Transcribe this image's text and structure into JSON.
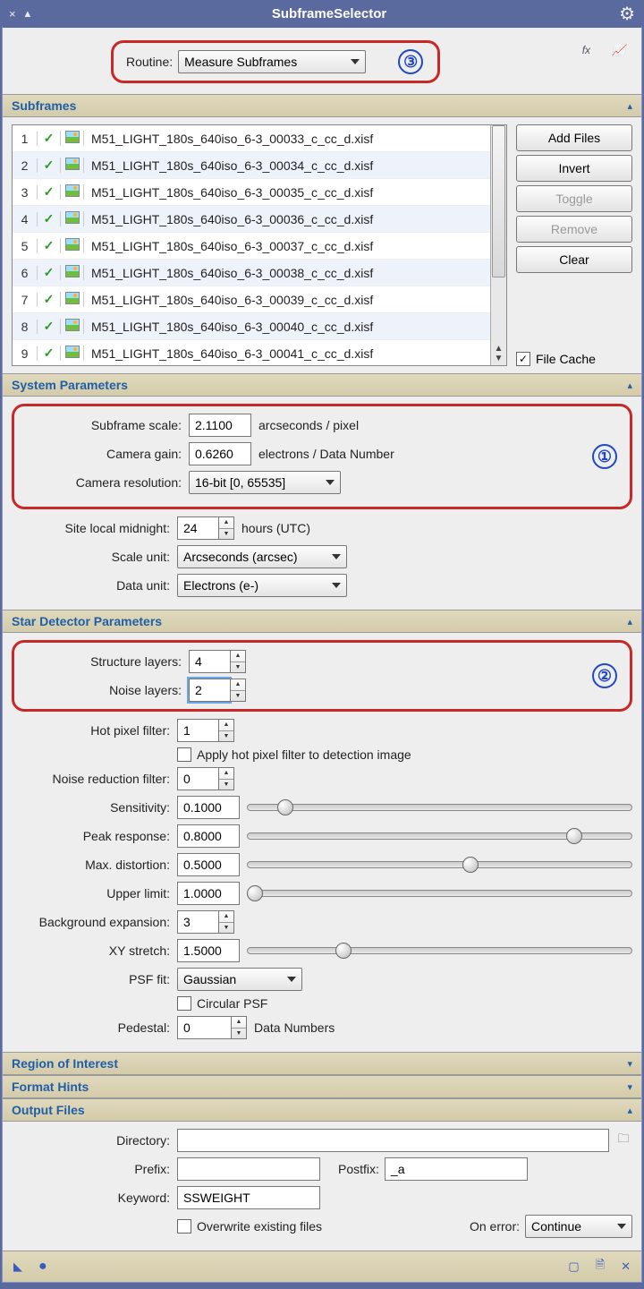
{
  "title": "SubframeSelector",
  "routine": {
    "label": "Routine:",
    "value": "Measure Subframes",
    "mark": "③"
  },
  "sections": {
    "subframes": {
      "name": "Subframes",
      "files": [
        "M51_LIGHT_180s_640iso_6-3_00033_c_cc_d.xisf",
        "M51_LIGHT_180s_640iso_6-3_00034_c_cc_d.xisf",
        "M51_LIGHT_180s_640iso_6-3_00035_c_cc_d.xisf",
        "M51_LIGHT_180s_640iso_6-3_00036_c_cc_d.xisf",
        "M51_LIGHT_180s_640iso_6-3_00037_c_cc_d.xisf",
        "M51_LIGHT_180s_640iso_6-3_00038_c_cc_d.xisf",
        "M51_LIGHT_180s_640iso_6-3_00039_c_cc_d.xisf",
        "M51_LIGHT_180s_640iso_6-3_00040_c_cc_d.xisf",
        "M51_LIGHT_180s_640iso_6-3_00041_c_cc_d.xisf"
      ],
      "buttons": {
        "add": "Add Files",
        "invert": "Invert",
        "toggle": "Toggle",
        "remove": "Remove",
        "clear": "Clear"
      },
      "filecache_label": "File Cache"
    },
    "system": {
      "name": "System Parameters",
      "subframe_scale": {
        "label": "Subframe scale:",
        "value": "2.1100",
        "unit": "arcseconds / pixel"
      },
      "camera_gain": {
        "label": "Camera gain:",
        "value": "0.6260",
        "unit": "electrons / Data Number"
      },
      "camera_res": {
        "label": "Camera resolution:",
        "value": "16-bit [0, 65535]"
      },
      "midnight": {
        "label": "Site local midnight:",
        "value": "24",
        "unit": "hours (UTC)"
      },
      "scale_unit": {
        "label": "Scale unit:",
        "value": "Arcseconds (arcsec)"
      },
      "data_unit": {
        "label": "Data unit:",
        "value": "Electrons (e-)"
      },
      "mark": "①"
    },
    "star": {
      "name": "Star Detector Parameters",
      "structure_layers": {
        "label": "Structure layers:",
        "value": "4"
      },
      "noise_layers": {
        "label": "Noise layers:",
        "value": "2"
      },
      "hot_pixel": {
        "label": "Hot pixel filter:",
        "value": "1"
      },
      "hot_pixel_check": "Apply hot pixel filter to detection image",
      "noise_reduction": {
        "label": "Noise reduction filter:",
        "value": "0"
      },
      "sensitivity": {
        "label": "Sensitivity:",
        "value": "0.1000",
        "slider": 10
      },
      "peak": {
        "label": "Peak response:",
        "value": "0.8000",
        "slider": 85
      },
      "distortion": {
        "label": "Max. distortion:",
        "value": "0.5000",
        "slider": 58
      },
      "upper": {
        "label": "Upper limit:",
        "value": "1.0000",
        "slider": 2
      },
      "bgexp": {
        "label": "Background expansion:",
        "value": "3"
      },
      "xystretch": {
        "label": "XY stretch:",
        "value": "1.5000",
        "slider": 25
      },
      "psf": {
        "label": "PSF fit:",
        "value": "Gaussian"
      },
      "circular": "Circular PSF",
      "pedestal": {
        "label": "Pedestal:",
        "value": "0",
        "unit": "Data Numbers"
      },
      "mark": "②"
    },
    "roi": {
      "name": "Region of Interest"
    },
    "hints": {
      "name": "Format Hints"
    },
    "output": {
      "name": "Output Files",
      "directory": {
        "label": "Directory:",
        "value": ""
      },
      "prefix": {
        "label": "Prefix:",
        "value": ""
      },
      "postfix": {
        "label": "Postfix:",
        "value": "_a"
      },
      "keyword": {
        "label": "Keyword:",
        "value": "SSWEIGHT"
      },
      "overwrite": "Overwrite existing files",
      "onerror": {
        "label": "On error:",
        "value": "Continue"
      }
    }
  },
  "topicons": {
    "fx": "fx"
  }
}
